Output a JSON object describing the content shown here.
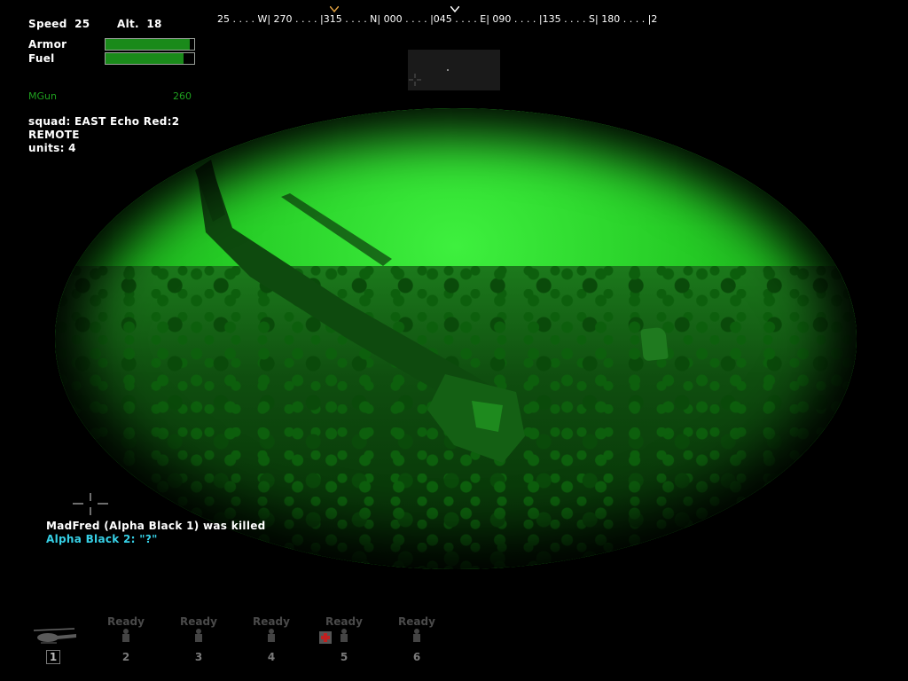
{
  "status": {
    "speed_label": "Speed",
    "speed_value": "25",
    "alt_label": "Alt.",
    "alt_value": "18",
    "armor_label": "Armor",
    "armor_level": 0.95,
    "fuel_label": "Fuel",
    "fuel_level": 0.88,
    "weapon_name": "MGun",
    "weapon_ammo": "260"
  },
  "compass": {
    "strip": "25 . . . . W| 270 . . . . |315 . . . . N| 000 . . . . |045 . . . . E| 090 . . . . |135 . . . . S| 180 . . . . |2"
  },
  "squad": {
    "line1": "squad: EAST Echo Red:2",
    "line2": "REMOTE",
    "line3": "units: 4"
  },
  "messages": {
    "kill": "MadFred (Alpha Black 1) was killed",
    "chat": "Alpha Black 2: \"?\""
  },
  "units": [
    {
      "status": "",
      "number": "1",
      "type": "helicopter-icon",
      "selected": true
    },
    {
      "status": "Ready",
      "number": "2",
      "type": "soldier-icon"
    },
    {
      "status": "Ready",
      "number": "3",
      "type": "soldier-icon"
    },
    {
      "status": "Ready",
      "number": "4",
      "type": "soldier-icon"
    },
    {
      "status": "Ready",
      "number": "5",
      "type": "soldier-icon",
      "medic": true
    },
    {
      "status": "Ready",
      "number": "6",
      "type": "soldier-icon"
    }
  ],
  "colors": {
    "nv_green": "#26cc26",
    "bar_green": "#1a8a1a",
    "weapon_green": "#1fa01f",
    "chat_cyan": "#36d0e6"
  }
}
